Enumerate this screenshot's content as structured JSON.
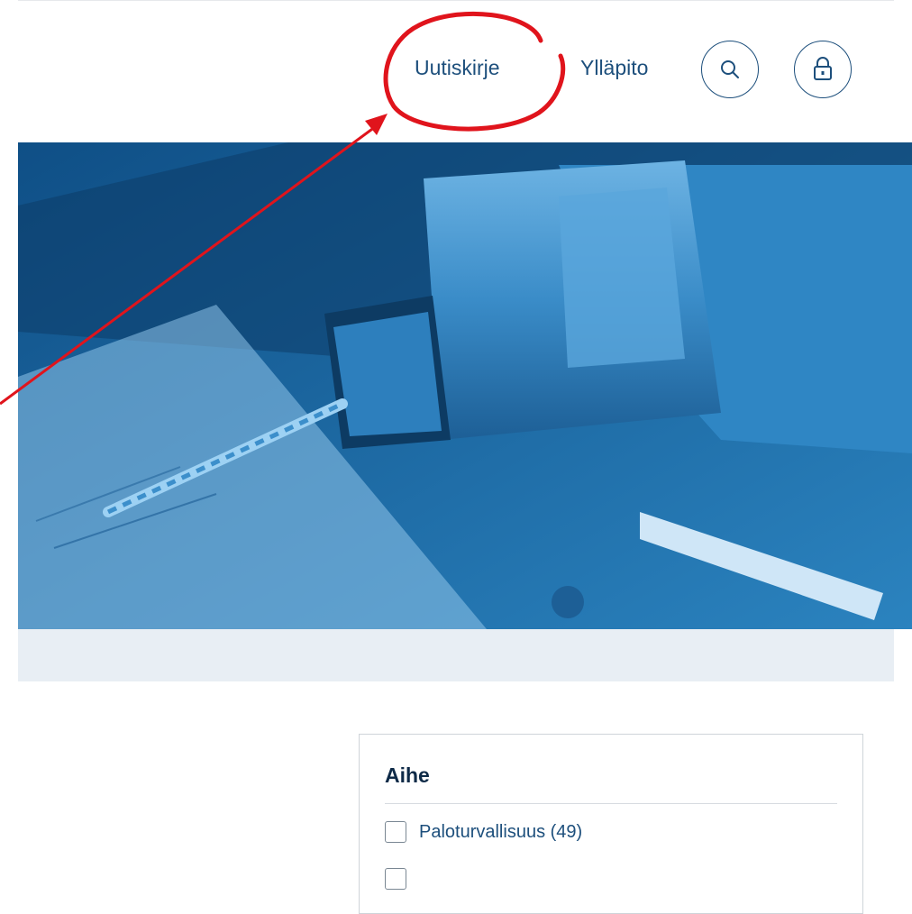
{
  "header": {
    "nav": [
      {
        "label": "Uutiskirje"
      },
      {
        "label": "Ylläpito"
      }
    ],
    "search_icon": "search-icon",
    "login_icon": "lock-icon"
  },
  "hero": {
    "image": "drill-with-bit-photo",
    "tint_color": "#1f6fa8"
  },
  "filter": {
    "title": "Aihe",
    "options": [
      {
        "label": "Paloturvallisuus (49)"
      }
    ]
  },
  "annotation": {
    "highlight_color": "#e0141c",
    "target": "Uutiskirje"
  }
}
